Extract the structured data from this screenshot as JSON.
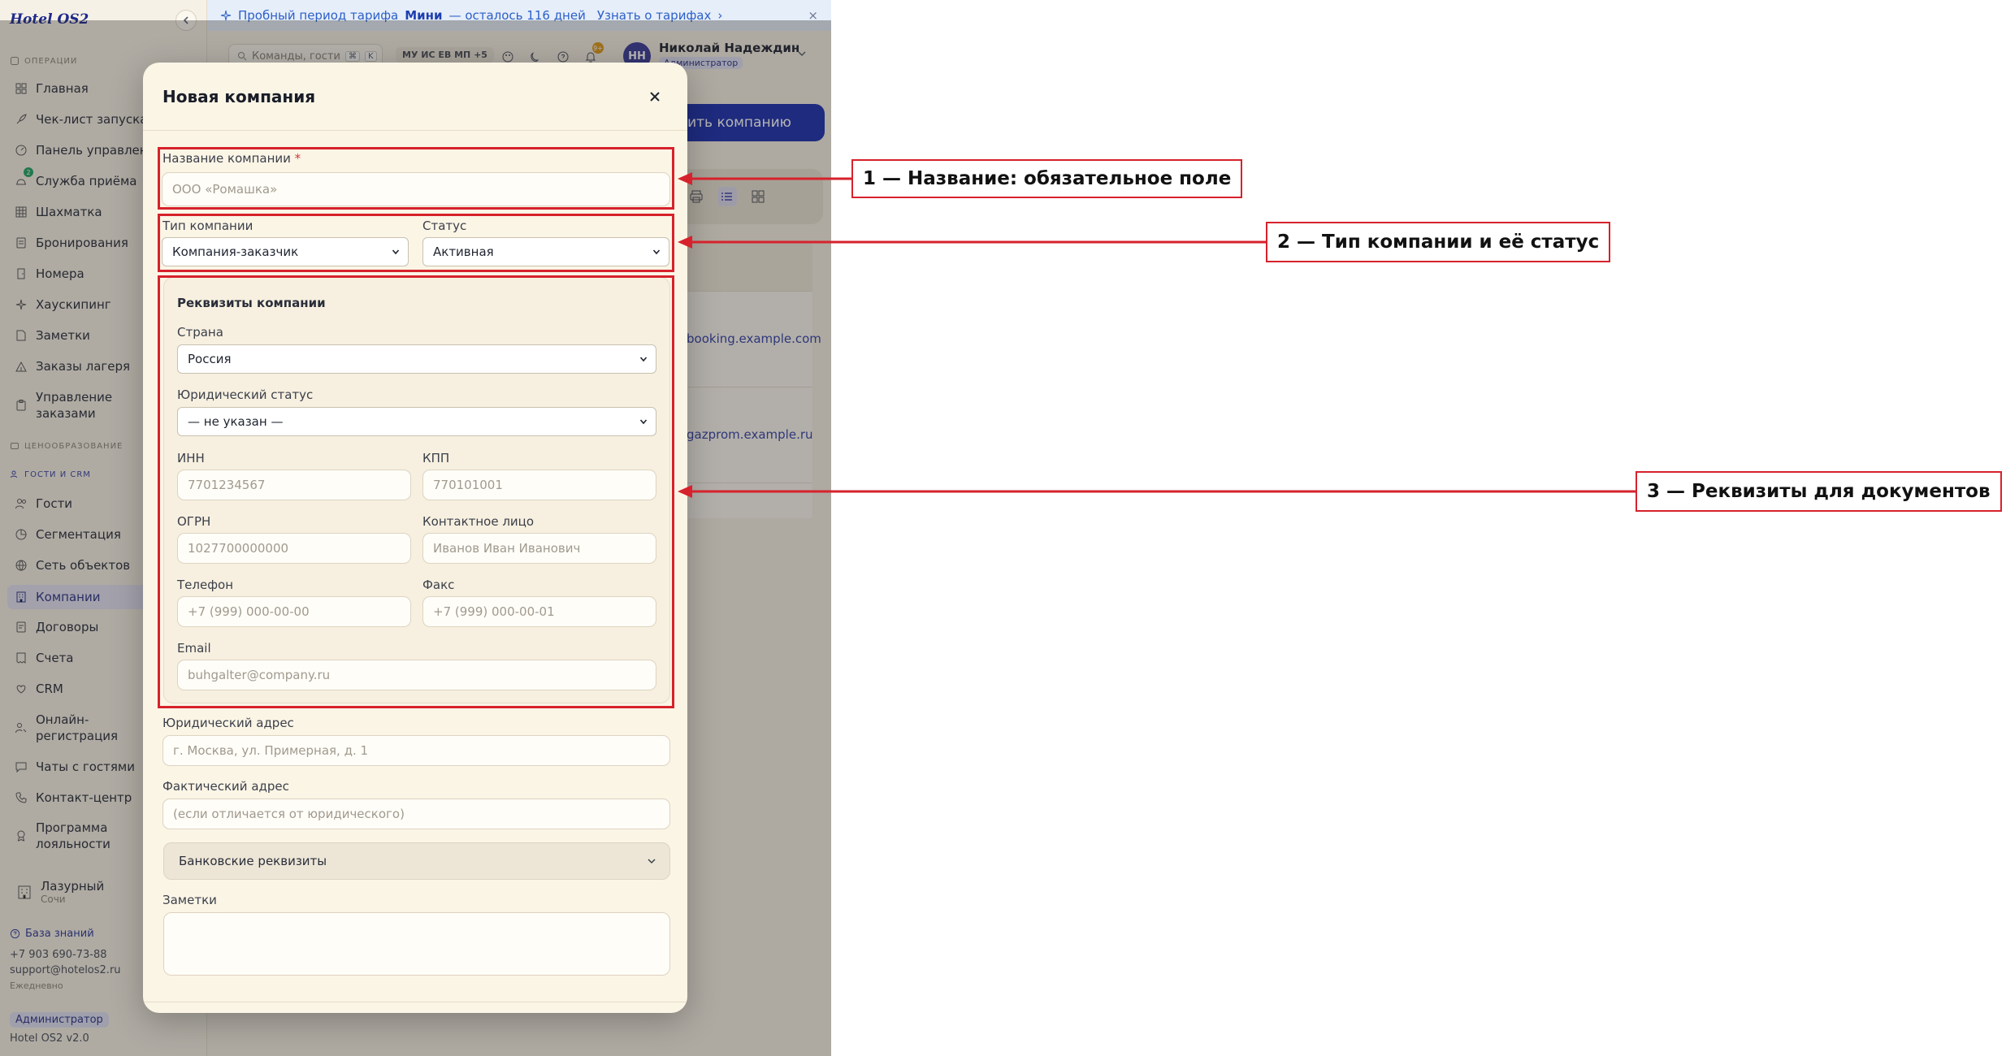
{
  "app": {
    "logo": "Hotel OS2"
  },
  "sidebar": {
    "sections": {
      "operations": "ОПЕРАЦИИ",
      "pricing": "ЦЕНООБРАЗОВАНИЕ",
      "crm": "ГОСТИ И CRM"
    },
    "items": [
      {
        "label": "Главная",
        "icon": "grid-icon"
      },
      {
        "label": "Чек-лист запуска",
        "icon": "rocket-icon"
      },
      {
        "label": "Панель управлен",
        "icon": "gauge-icon"
      },
      {
        "label": "Служба приёма",
        "icon": "concierge-bell-icon",
        "badge": "2"
      },
      {
        "label": "Шахматка",
        "icon": "calendar-grid-icon"
      },
      {
        "label": "Бронирования",
        "icon": "document-icon"
      },
      {
        "label": "Номера",
        "icon": "door-icon"
      },
      {
        "label": "Хаускипинг",
        "icon": "sparkles-icon"
      },
      {
        "label": "Заметки",
        "icon": "note-icon"
      },
      {
        "label": "Заказы лагеря",
        "icon": "tent-icon"
      },
      {
        "label": "Управление",
        "label2": "заказами",
        "icon": "clipboard-icon"
      },
      {
        "label": "Гости",
        "icon": "users-icon"
      },
      {
        "label": "Сегментация",
        "icon": "pie-chart-icon"
      },
      {
        "label": "Сеть объектов",
        "icon": "network-icon"
      },
      {
        "label": "Компании",
        "icon": "building-icon"
      },
      {
        "label": "Договоры",
        "icon": "contract-icon"
      },
      {
        "label": "Счета",
        "icon": "invoice-icon"
      },
      {
        "label": "CRM",
        "icon": "heart-icon"
      },
      {
        "label": "Онлайн-",
        "label2": "регистрация",
        "icon": "user-key-icon"
      },
      {
        "label": "Чаты с гостями",
        "icon": "chat-icon"
      },
      {
        "label": "Контакт-центр",
        "icon": "phone-icon"
      },
      {
        "label": "Программа",
        "label2": "лояльности",
        "icon": "award-icon"
      }
    ],
    "hotel": {
      "name": "Лазурный",
      "city": "Сочи"
    },
    "knowledge_base": "База знаний",
    "phone": "+7 903 690-73-88",
    "email": "support@hotelos2.ru",
    "schedule": "Ежедневно",
    "role": "Администратор",
    "version": "Hotel OS2 v2.0"
  },
  "trial_banner": {
    "prefix": "Пробный период тарифа",
    "plan": "Мини",
    "suffix": "— осталось 116 дней",
    "link": "Узнать о тарифах",
    "close": "×"
  },
  "topbar": {
    "search_placeholder": "Команды, гости",
    "kbd1": "⌘",
    "kbd2": "K",
    "languages": "МУ ИС ЕВ МП +5",
    "notifications_count": "9+",
    "user": {
      "initials": "НН",
      "name": "Николай Надеждин",
      "role": "Администратор"
    }
  },
  "main": {
    "add_company_button": "вить компанию",
    "rows": [
      {
        "email": "booking.example.com"
      },
      {
        "email": "gazprom.example.ru"
      }
    ]
  },
  "modal": {
    "title": "Новая компания",
    "name_label": "Название компании",
    "required_mark": "*",
    "name_placeholder": "ООО «Ромашка»",
    "type_label": "Тип компании",
    "type_value": "Компания-заказчик",
    "status_label": "Статус",
    "status_value": "Активная",
    "requisites": {
      "title": "Реквизиты компании",
      "country_label": "Страна",
      "country_value": "Россия",
      "legal_status_label": "Юридический статус",
      "legal_status_value": "— не указан —",
      "inn_label": "ИНН",
      "inn_placeholder": "7701234567",
      "kpp_label": "КПП",
      "kpp_placeholder": "770101001",
      "ogrn_label": "ОГРН",
      "ogrn_placeholder": "1027700000000",
      "contact_label": "Контактное лицо",
      "contact_placeholder": "Иванов Иван Иванович",
      "phone_label": "Телефон",
      "phone_placeholder": "+7 (999) 000-00-00",
      "fax_label": "Факс",
      "fax_placeholder": "+7 (999) 000-00-01",
      "email_label": "Email",
      "email_placeholder": "buhgalter@company.ru"
    },
    "legal_address_label": "Юридический адрес",
    "legal_address_placeholder": "г. Москва, ул. Примерная, д. 1",
    "actual_address_label": "Фактический адрес",
    "actual_address_placeholder": "(если отличается от юридического)",
    "bank_label": "Банковские реквизиты",
    "notes_label": "Заметки"
  },
  "annotations": [
    {
      "text": "1 — Название: обязательное поле"
    },
    {
      "text": "2 — Тип компании и её статус"
    },
    {
      "text": "3 — Реквизиты для документов"
    }
  ],
  "colors": {
    "accent": "#1b2fae",
    "annotation": "#d6222c",
    "modal_bg": "#fbf5e6"
  }
}
